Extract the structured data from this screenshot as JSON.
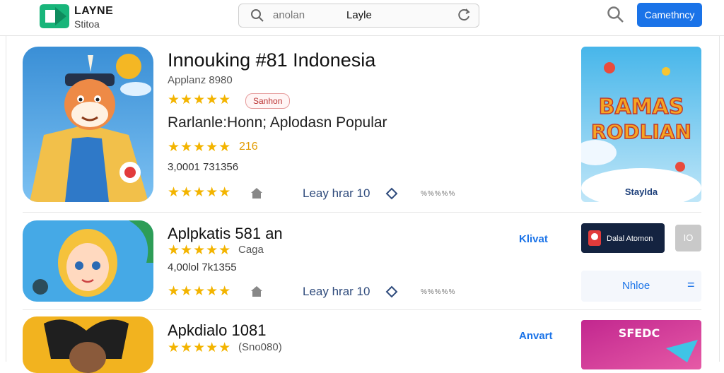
{
  "header": {
    "brand": "LAYNE",
    "brand_sub": "Stitoa",
    "search_placeholder": "anolan",
    "search_value": "Layle",
    "category_button": "Camethncy"
  },
  "featured": {
    "title": "Innouking #81 Indonesia",
    "publisher": "Applanz 8980",
    "tag": "Sanhon",
    "category": "Rarlanle:Honn; Aplodasn Popular",
    "rating": "216",
    "code": "3,0001 731356",
    "link": "Leay hrar 10",
    "tiny": "%%%%%",
    "promo": {
      "line1": "BAMAS",
      "line2": "RODLIAN",
      "caption": "Staylda"
    }
  },
  "rows": [
    {
      "title": "Aplpkatis 581 an",
      "sub": "Caga",
      "code": "4,00lol 7k1355",
      "link": "Leay hrar 10",
      "tiny": "%%%%%",
      "install": "Klivat",
      "badge": "Dalal Atomon",
      "sq_btn": "IO",
      "ghost_btn": "Nhloe",
      "ghost_icon": "="
    },
    {
      "title": "Apkdialo 1081",
      "sub": "(Sno080)",
      "install": "Anvart",
      "promo": "SFEDC"
    }
  ]
}
